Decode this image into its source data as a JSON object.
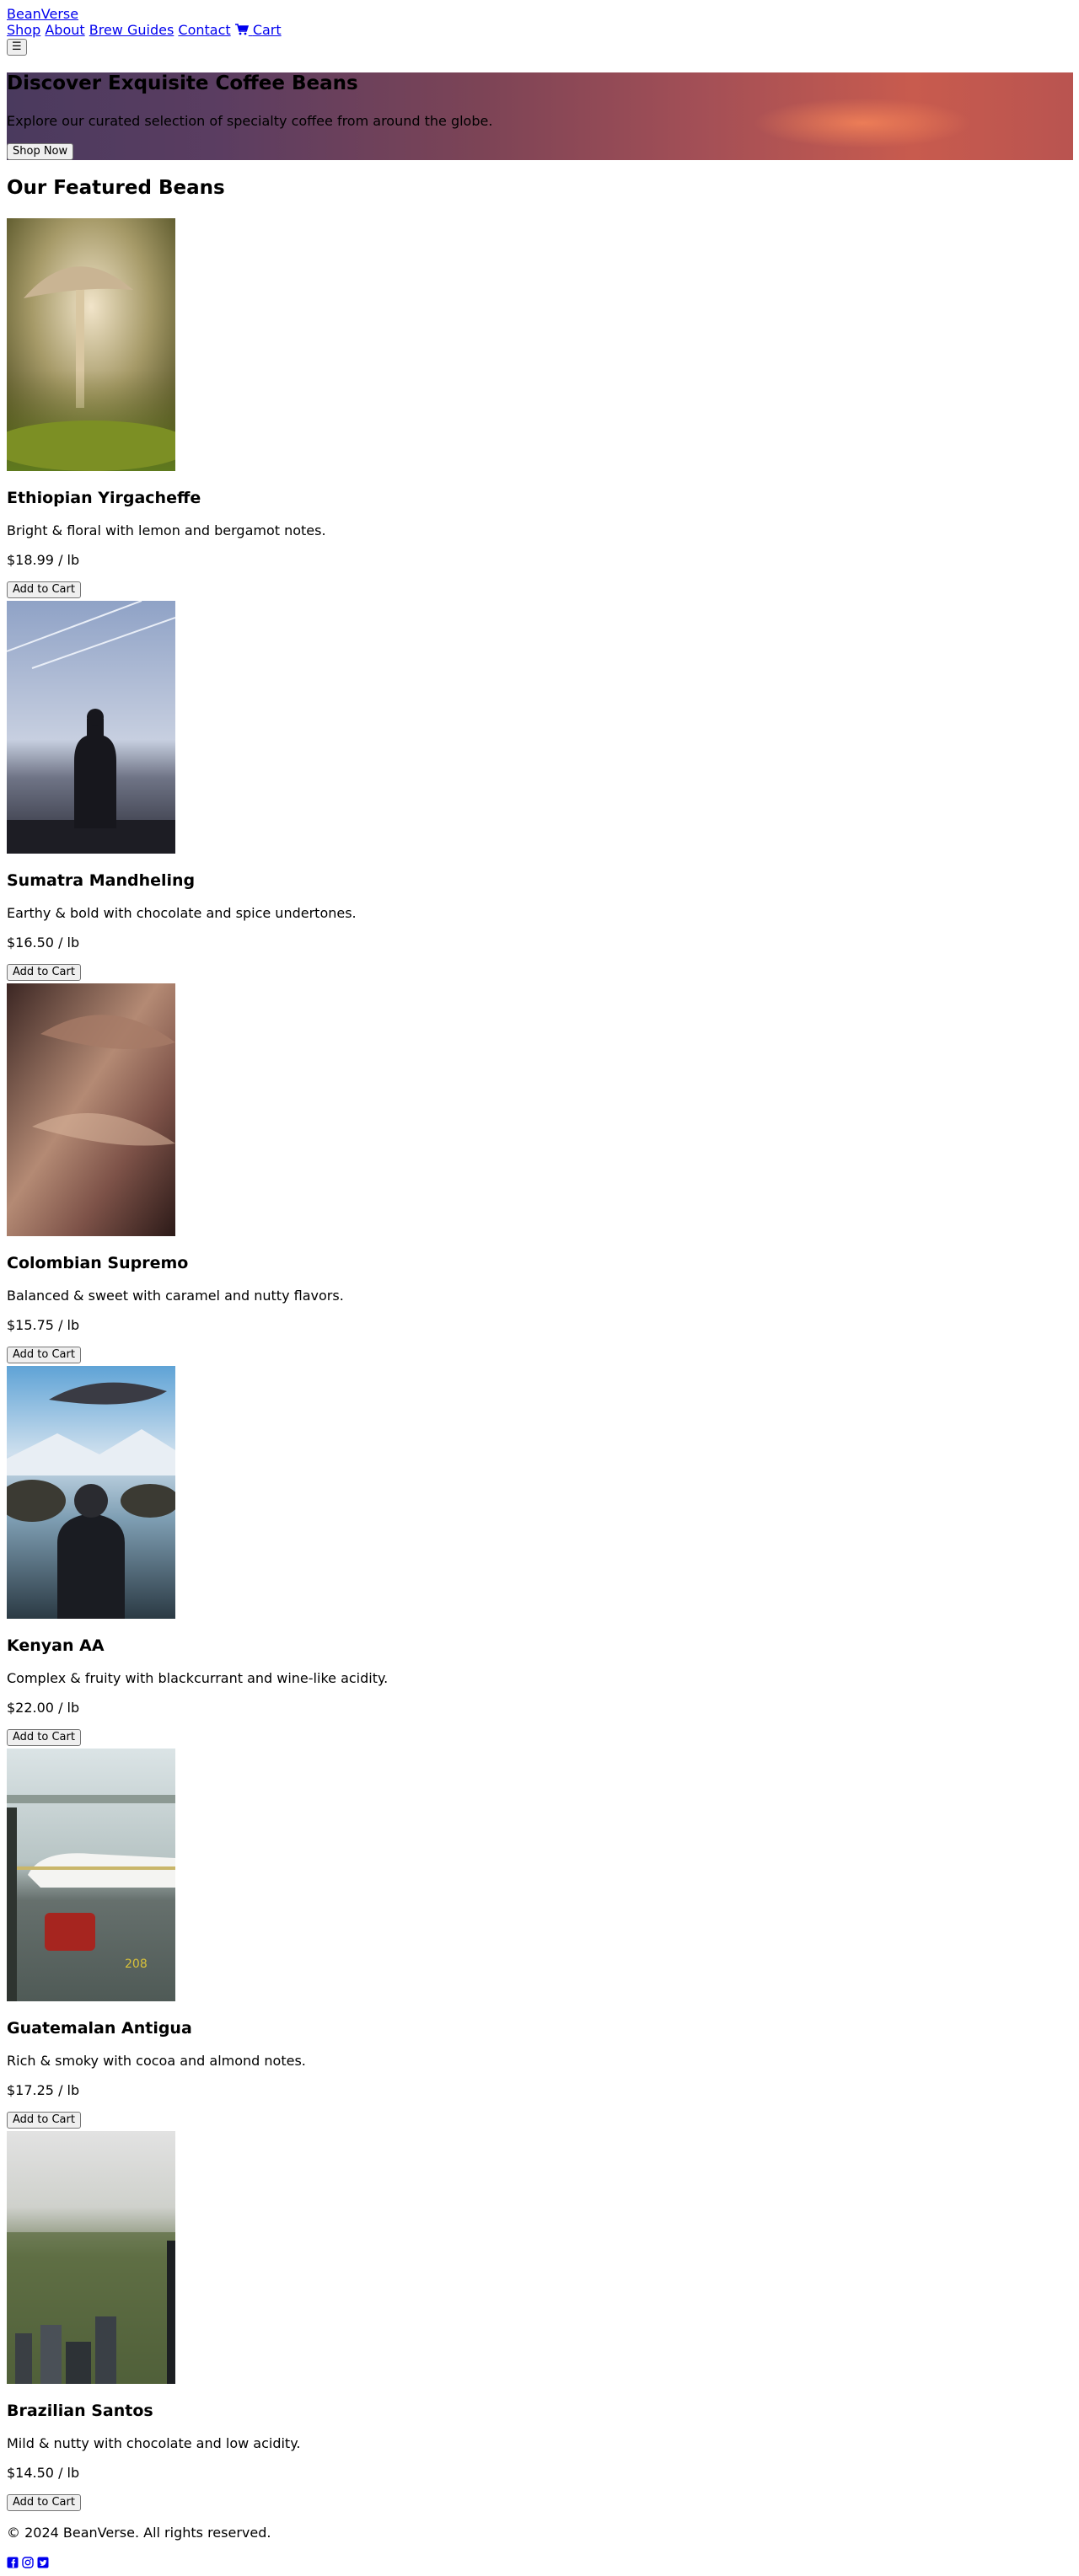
{
  "nav": {
    "brand": "BeanVerse",
    "links": [
      "Shop",
      "About",
      "Brew Guides",
      "Contact"
    ],
    "cart_label": "Cart",
    "menu_toggle": "☰"
  },
  "hero": {
    "title": "Discover Exquisite Coffee Beans",
    "subtitle": "Explore our curated selection of specialty coffee from around the globe.",
    "cta": "Shop Now"
  },
  "featured": {
    "heading": "Our Featured Beans",
    "products": [
      {
        "name": "Ethiopian Yirgacheffe",
        "desc": "Bright & floral with lemon and bergamot notes.",
        "price": "$18.99 / lb",
        "button": "Add to Cart"
      },
      {
        "name": "Sumatra Mandheling",
        "desc": "Earthy & bold with chocolate and spice undertones.",
        "price": "$16.50 / lb",
        "button": "Add to Cart"
      },
      {
        "name": "Colombian Supremo",
        "desc": "Balanced & sweet with caramel and nutty flavors.",
        "price": "$15.75 / lb",
        "button": "Add to Cart"
      },
      {
        "name": "Kenyan AA",
        "desc": "Complex & fruity with blackcurrant and wine-like acidity.",
        "price": "$22.00 / lb",
        "button": "Add to Cart"
      },
      {
        "name": "Guatemalan Antigua",
        "desc": "Rich & smoky with cocoa and almond notes.",
        "price": "$17.25 / lb",
        "button": "Add to Cart"
      },
      {
        "name": "Brazilian Santos",
        "desc": "Mild & nutty with chocolate and low acidity.",
        "price": "$14.50 / lb",
        "button": "Add to Cart"
      }
    ]
  },
  "footer": {
    "copyright": "© 2024 BeanVerse. All rights reserved.",
    "social_icons": [
      "facebook-icon",
      "instagram-icon",
      "twitter-icon"
    ]
  }
}
